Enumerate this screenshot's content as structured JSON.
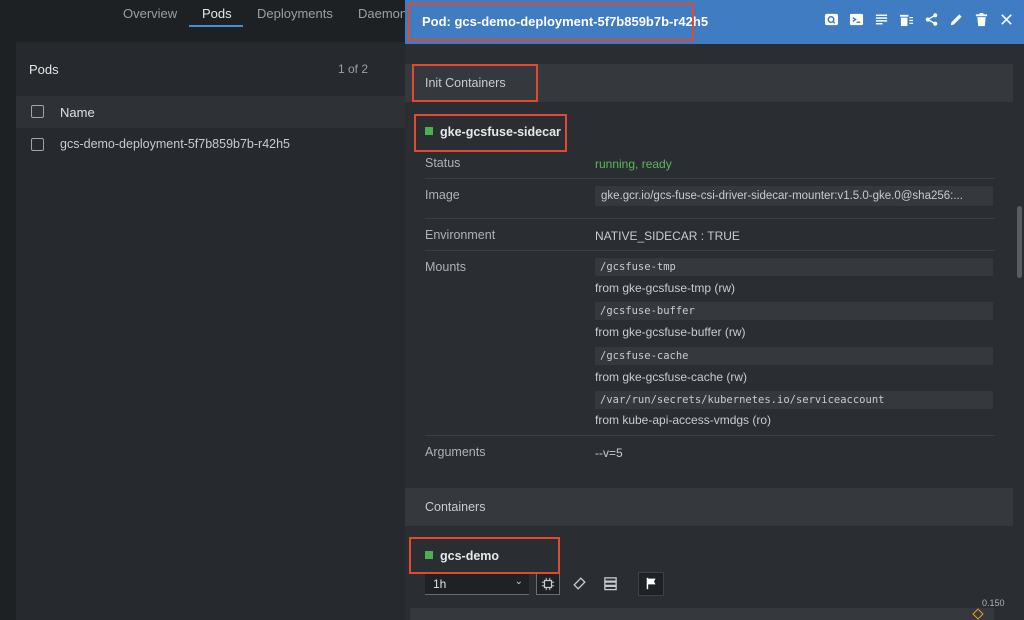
{
  "tabs": [
    "Overview",
    "Pods",
    "Deployments",
    "Daemon"
  ],
  "pods_panel": {
    "title": "Pods",
    "count": "1 of 2",
    "column_name": "Name",
    "rows": [
      "gcs-demo-deployment-5f7b859b7b-r42h5"
    ]
  },
  "drawer": {
    "title": "Pod: gcs-demo-deployment-5f7b859b7b-r42h5",
    "header_icons": [
      "search-icon",
      "terminal-icon",
      "logs-icon",
      "delete-pod-icon",
      "share-icon",
      "edit-icon",
      "trash-icon",
      "close-icon"
    ],
    "init_section": "Init Containers",
    "init_container": {
      "name": "gke-gcsfuse-sidecar",
      "status_label": "Status",
      "status_value": "running, ready",
      "image_label": "Image",
      "image_value": "gke.gcr.io/gcs-fuse-csi-driver-sidecar-mounter:v1.5.0-gke.0@sha256:...",
      "env_label": "Environment",
      "env_value": "NATIVE_SIDECAR : TRUE",
      "mounts_label": "Mounts",
      "mounts": [
        {
          "path": "/gcsfuse-tmp",
          "from": "from gke-gcsfuse-tmp (rw)"
        },
        {
          "path": "/gcsfuse-buffer",
          "from": "from gke-gcsfuse-buffer (rw)"
        },
        {
          "path": "/gcsfuse-cache",
          "from": "from gke-gcsfuse-cache (rw)"
        },
        {
          "path": "/var/run/secrets/kubernetes.io/serviceaccount",
          "from": "from kube-api-access-vmdgs (ro)"
        }
      ],
      "args_label": "Arguments",
      "args_value": "--v=5"
    },
    "containers_section": "Containers",
    "container": {
      "name": "gcs-demo",
      "range_select": "1h",
      "metric_value": "0.150"
    }
  },
  "colors": {
    "header": "#3f7cc1",
    "highlight": "#e04a2f",
    "ready": "#5cb85c",
    "status_dot": "#4caf50"
  }
}
